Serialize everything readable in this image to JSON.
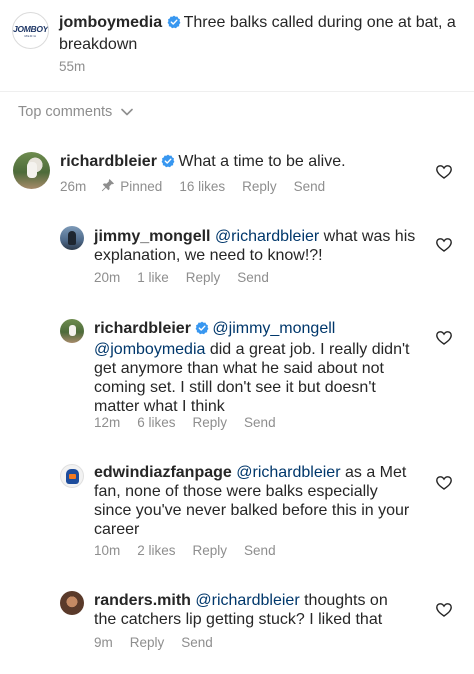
{
  "post": {
    "username": "jomboymedia",
    "caption": "Three balks called during one at bat, a breakdown",
    "time": "55m",
    "logo_text": "JOMBOY",
    "logo_subtext": "MEDIA"
  },
  "sort": {
    "label": "Top comments"
  },
  "comments": [
    {
      "username": "richardbleier",
      "verified": true,
      "text": "What a time to be alive.",
      "time": "26m",
      "pinned_label": "Pinned",
      "likes": "16 likes",
      "reply_label": "Reply",
      "send_label": "Send"
    },
    {
      "username": "jimmy_mongell",
      "mention": "@richardbleier",
      "text_line1": " what was his",
      "text_line2": "explanation, we need to know!?!",
      "time": "20m",
      "likes": "1 like",
      "reply_label": "Reply",
      "send_label": "Send"
    },
    {
      "username": "richardbleier",
      "verified": true,
      "mention1": "@jimmy_mongell",
      "mention2": "@jomboymedia",
      "line2_rest": " did a great job. I really didn't",
      "line3": "get anymore than what he said about not",
      "line4": "coming set. I still don't see it but doesn't",
      "line5": "matter what I think",
      "time": "12m",
      "likes": "6 likes",
      "reply_label": "Reply",
      "send_label": "Send"
    },
    {
      "username": "edwindiazfanpage",
      "mention": "@richardbleier",
      "line1_rest": " as a Met",
      "line2": "fan, none of those were balks especially",
      "line3": "since you've never balked before this in your",
      "line4": "career",
      "time": "10m",
      "likes": "2 likes",
      "reply_label": "Reply",
      "send_label": "Send"
    },
    {
      "username": "randers.mith",
      "mention": "@richardbleier",
      "line1_rest": " thoughts on",
      "line2": "the catchers lip getting stuck? I liked that",
      "time": "9m",
      "reply_label": "Reply",
      "send_label": "Send"
    }
  ],
  "colors": {
    "text": "#262626",
    "secondary": "#8e8e8e",
    "mention": "#00376b",
    "verified": "#3897f0"
  }
}
